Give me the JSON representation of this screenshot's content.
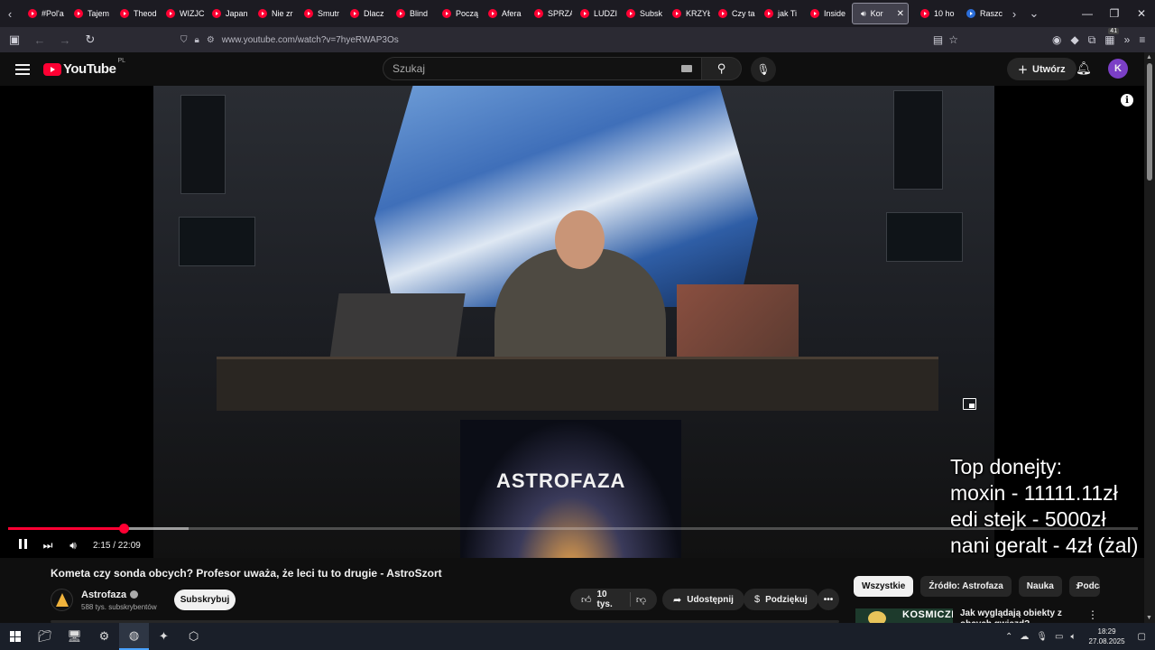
{
  "browser": {
    "tabs": [
      {
        "label": "#Pol'a",
        "favicon": "youtube"
      },
      {
        "label": "Tajem",
        "favicon": "youtube"
      },
      {
        "label": "Theod",
        "favicon": "youtube"
      },
      {
        "label": "WIZJC",
        "favicon": "youtube"
      },
      {
        "label": "Japan",
        "favicon": "youtube"
      },
      {
        "label": "Nie zr",
        "favicon": "youtube"
      },
      {
        "label": "Smutr",
        "favicon": "youtube"
      },
      {
        "label": "Dlacz",
        "favicon": "youtube"
      },
      {
        "label": "Blind",
        "favicon": "youtube"
      },
      {
        "label": "Począ",
        "favicon": "youtube"
      },
      {
        "label": "Afera",
        "favicon": "youtube"
      },
      {
        "label": "SPRZA",
        "favicon": "youtube"
      },
      {
        "label": "LUDZI",
        "favicon": "youtube"
      },
      {
        "label": "Subsk",
        "favicon": "youtube"
      },
      {
        "label": "KRZYŁ",
        "favicon": "youtube"
      },
      {
        "label": "Czy ta",
        "favicon": "youtube"
      },
      {
        "label": "jak Ti",
        "favicon": "youtube"
      },
      {
        "label": "Inside",
        "favicon": "youtube"
      }
    ],
    "active_tab": {
      "label": "Kor",
      "close": "✕"
    },
    "tabs_after": [
      {
        "label": "10 ho",
        "favicon": "youtube"
      },
      {
        "label": "Raszc",
        "favicon": "other"
      }
    ],
    "url": "www.youtube.com/watch?v=7hyeRWAP3Os",
    "extension_badge": "41"
  },
  "youtube": {
    "logo_text": "YouTube",
    "country_code": "PL",
    "search_placeholder": "Szukaj",
    "create_label": "Utwórz",
    "avatar_letter": "K"
  },
  "video": {
    "brand_text": "ASTROFAZA",
    "progress": {
      "played_fraction": 0.102,
      "buffered_fraction": 0.16
    },
    "time_display": "2:15 / 22:09",
    "info_icon_text": "i",
    "donations": [
      "Top donejty:",
      "moxin - 11111.11zł",
      "edi stejk - 5000zł",
      "nani geralt - 4zł (żal)"
    ]
  },
  "below": {
    "title": "Kometa czy sonda obcych? Profesor uważa, że leci tu to drugie - AstroSzort",
    "channel_name": "Astrofaza",
    "subscribers": "588 tys. subskrybentów",
    "subscribe_label": "Subskrybuj",
    "likes": "10 tys.",
    "share_label": "Udostępnij",
    "thanks_label": "Podziękuj",
    "more_label": "•••",
    "chips": [
      "Wszystkie",
      "Źródło: Astrofaza",
      "Nauka",
      "Podcasty"
    ],
    "rec_thumb_text": "KOSMICZNI",
    "rec_title": "Jak wyglądają obiekty z obcych gwiazd?"
  },
  "taskbar": {
    "time": "18:29",
    "date": "27.08.2025"
  },
  "colors": {
    "accent_red": "#ff0033",
    "background": "#0f0f0f",
    "browser_bg": "#2b2a33"
  }
}
